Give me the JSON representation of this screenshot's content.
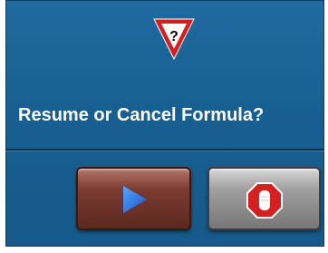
{
  "dialog": {
    "question": "Resume or Cancel Formula?",
    "icon": "warning-question-yield-icon",
    "buttons": {
      "resume": {
        "icon": "play-icon"
      },
      "cancel": {
        "icon": "stop-hand-icon"
      }
    }
  },
  "colors": {
    "panel": "#185f91",
    "resume_button": "#7a3b31",
    "cancel_button": "#9f9f9f",
    "play": "#1e73e0",
    "stop": "#d61f1f"
  }
}
